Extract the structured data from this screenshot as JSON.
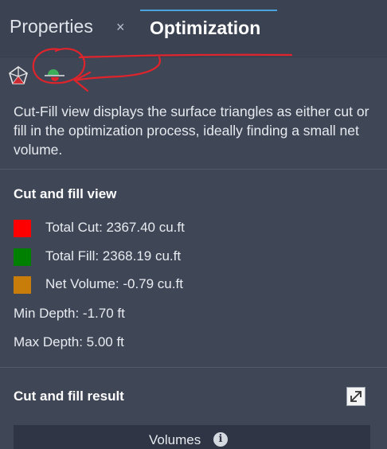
{
  "tabs": [
    {
      "label": "Properties",
      "close_glyph": "×"
    },
    {
      "label": "Optimization",
      "active": true
    }
  ],
  "toolbar": {
    "icons": [
      "surface-mesh-icon",
      "cut-fill-icon"
    ]
  },
  "description": "Cut-Fill view displays the surface triangles as either cut or fill in the optimization process, ideally finding a small net volume.",
  "cut_fill_view": {
    "title": "Cut and fill view",
    "items": [
      {
        "label": "Total Cut: 2367.40 cu.ft",
        "color": "#ff0000"
      },
      {
        "label": "Total Fill: 2368.19 cu.ft",
        "color": "#008000"
      },
      {
        "label": "Net Volume: -0.79 cu.ft",
        "color": "#c87c0a"
      }
    ],
    "min_depth": "Min Depth: -1.70 ft",
    "max_depth": "Max Depth: 5.00 ft"
  },
  "cut_fill_result": {
    "title": "Cut and fill result",
    "volumes_label": "Volumes",
    "info_glyph": "i"
  },
  "colors": {
    "panel_bg": "#3f4656",
    "active_tab_underline": "#4aa3df",
    "annotation": "#e0242c"
  }
}
